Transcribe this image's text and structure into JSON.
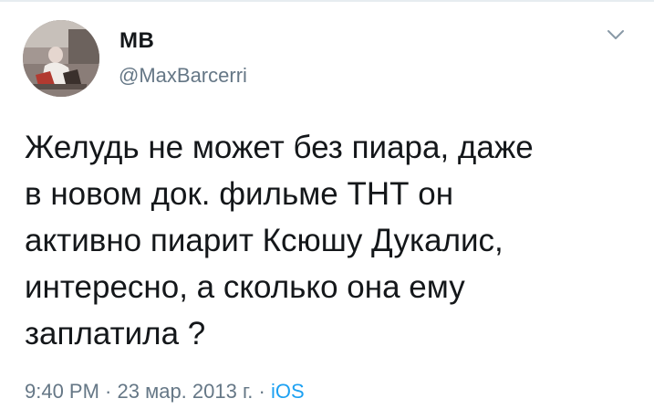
{
  "tweet": {
    "display_name": "МВ",
    "handle": "@MaxBarcerri",
    "text": "Желудь не может без пиара, даже\nв новом док. фильме ТНТ он\nактивно пиарит Ксюшу Дукалис,\nинтересно, а сколько она ему\nзаплатила ?",
    "time": "9:40 PM",
    "separator_1": " · ",
    "date": "23 мар. 2013 г.",
    "separator_2": " · ",
    "source": "iOS"
  },
  "icons": {
    "caret": "chevron-down-icon",
    "avatar": "user-avatar"
  },
  "colors": {
    "text": "#14171a",
    "secondary": "#657786",
    "link": "#1da1f2"
  }
}
